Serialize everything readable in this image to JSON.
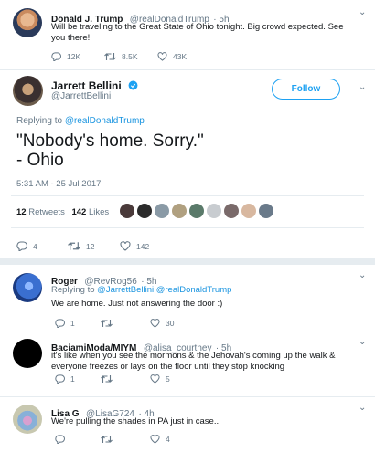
{
  "quoted_tweet": {
    "name": "Donald J. Trump",
    "handle": "@realDonaldTrump",
    "time": "· 5h",
    "text": "Will be traveling to the Great State of Ohio tonight. Big crowd expected. See you there!",
    "replies": "12K",
    "retweets": "8.5K",
    "likes": "43K"
  },
  "main_tweet": {
    "name": "Jarrett Bellini",
    "handle": "@JarrettBellini",
    "follow_label": "Follow",
    "replying_prefix": "Replying to",
    "replying_to": "@realDonaldTrump",
    "text_line1": "\"Nobody's home. Sorry.\"",
    "text_line2": "- Ohio",
    "timestamp": "5:31 AM - 25 Jul 2017",
    "retweets_count": "12",
    "retweets_label": "Retweets",
    "likes_count": "142",
    "likes_label": "Likes",
    "reply_count": "4",
    "retweet_action_count": "12",
    "like_action_count": "142"
  },
  "replies": [
    {
      "name": "Roger",
      "handle": "@RevRog56",
      "time": "· 5h",
      "replying_prefix": "Replying to",
      "replying_to": "@JarrettBellini @realDonaldTrump",
      "text": "We are home. Just not answering the door :)",
      "reply_count": "1",
      "like_count": "30"
    },
    {
      "name": "BaciamiModa/MIYM",
      "handle": "@alisa_courtney",
      "time": "· 5h",
      "text": "it's like when you see the mormons & the Jehovah's coming up the walk & everyone freezes or lays on the floor until they stop knocking",
      "reply_count": "1",
      "like_count": "5"
    },
    {
      "name": "Lisa G",
      "handle": "@LisaG724",
      "time": "· 4h",
      "text": "We're pulling the shades in PA just in case...",
      "like_count": "4"
    }
  ],
  "colors": {
    "accent": "#1da1f2",
    "link": "#1b95e0",
    "muted": "#657786",
    "background": "#e6ecf0"
  }
}
